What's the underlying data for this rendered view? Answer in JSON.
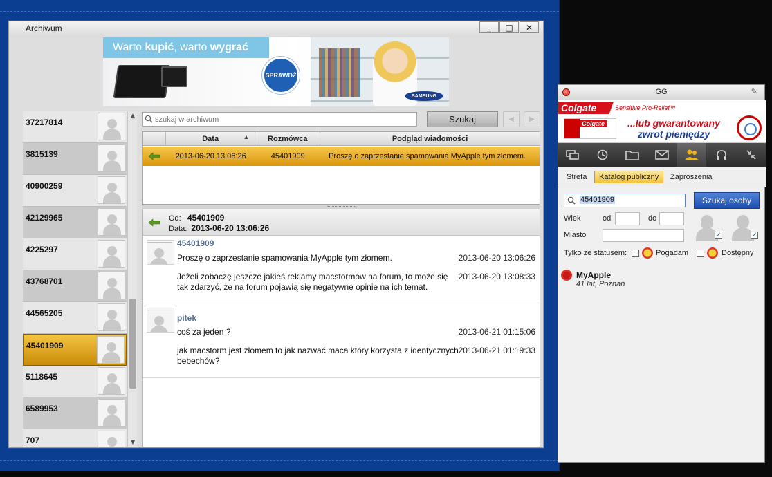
{
  "archive": {
    "title": "Archiwum",
    "buttons": {
      "minimize": "_",
      "maximize": "□",
      "close": "✕"
    },
    "banner": {
      "slogan_prefix": "Warto ",
      "slogan_bold1": "kupić",
      "slogan_mid": ", warto ",
      "slogan_bold2": "wygrać",
      "cta": "SPRAWDŹ",
      "brand": "SAMSUNG"
    },
    "contacts": [
      {
        "number": "37217814"
      },
      {
        "number": "3815139"
      },
      {
        "number": "40900259"
      },
      {
        "number": "42129965"
      },
      {
        "number": "4225297"
      },
      {
        "number": "43768701"
      },
      {
        "number": "44565205"
      },
      {
        "number": "45401909",
        "selected": true
      },
      {
        "number": "5118645"
      },
      {
        "number": "6589953"
      },
      {
        "number": "707"
      }
    ],
    "search": {
      "placeholder": "szukaj w archiwum",
      "button": "Szukaj"
    },
    "table": {
      "columns": [
        "Data",
        "Rozmówca",
        "Podgląd wiadomości"
      ],
      "rows": [
        {
          "date": "2013-06-20 13:06:26",
          "contact": "45401909",
          "preview": "Proszę o zaprzestanie spamowania MyApple tym złomem."
        }
      ]
    },
    "conversation": {
      "from_label": "Od:",
      "from_value": "45401909",
      "date_label": "Data:",
      "date_value": "2013-06-20 13:06:26",
      "messages": [
        {
          "author": "45401909",
          "lines": [
            {
              "text": "Proszę o zaprzestanie spamowania MyApple tym złomem.",
              "time": "2013-06-20 13:06:26"
            },
            {
              "text": "Jeżeli zobaczę jeszcze jakieś reklamy macstormów na forum, to może się tak zdarzyć, że na forum pojawią się negatywne opinie na ich temat.",
              "time": "2013-06-20 13:08:33"
            }
          ]
        },
        {
          "author": "pitek",
          "lines": [
            {
              "text": "coś za jeden ?",
              "time": "2013-06-21 01:15:06"
            },
            {
              "text": "jak macstorm jest złomem to jak nazwać maca który korzysta z identycznych bebechów?",
              "time": "2013-06-21 01:19:33"
            }
          ]
        }
      ]
    }
  },
  "gg": {
    "title": "GG",
    "ad": {
      "brand": "Colgate",
      "product": "Sensitive Pro-Relief™",
      "claim1": "...lub gwarantowany",
      "claim2": "zwrot pieniędzy"
    },
    "tabs": [
      "Strefa",
      "Katalog publiczny",
      "Zaproszenia"
    ],
    "active_tab": "Katalog publiczny",
    "search": {
      "value": "45401909",
      "button": "Szukaj osoby"
    },
    "filters": {
      "age_label": "Wiek",
      "from_label": "od",
      "to_label": "do",
      "city_label": "Miasto",
      "status_label": "Tylko ze statusem:",
      "status1": "Pogadam",
      "status2": "Dostępny"
    },
    "result": {
      "name": "MyApple",
      "info": "41 lat, Poznań"
    }
  },
  "colors": {
    "desktop_blue": "#0b3d91",
    "selection_gold": "#e3a317",
    "author_blue": "#55718f",
    "gg_button_blue": "#1e4fb3",
    "colgate_red": "#d8101a"
  }
}
